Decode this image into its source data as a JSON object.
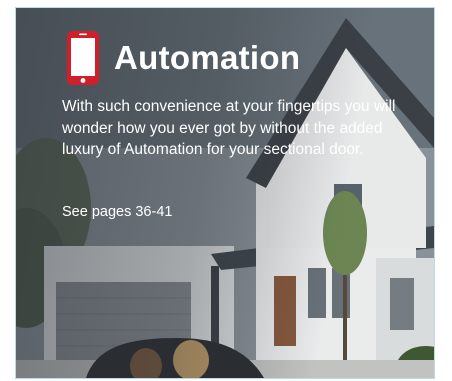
{
  "panel": {
    "icon": "mobile-phone-icon",
    "title": "Automation",
    "body": "With such convenience at your fingertips you will wonder how you ever got by without the added luxury of Automation for your sectional door.",
    "pages_link": "See pages 36-41"
  },
  "colors": {
    "icon_red": "#d01f2a",
    "text": "#ffffff",
    "card_border": "#b9dde2"
  }
}
